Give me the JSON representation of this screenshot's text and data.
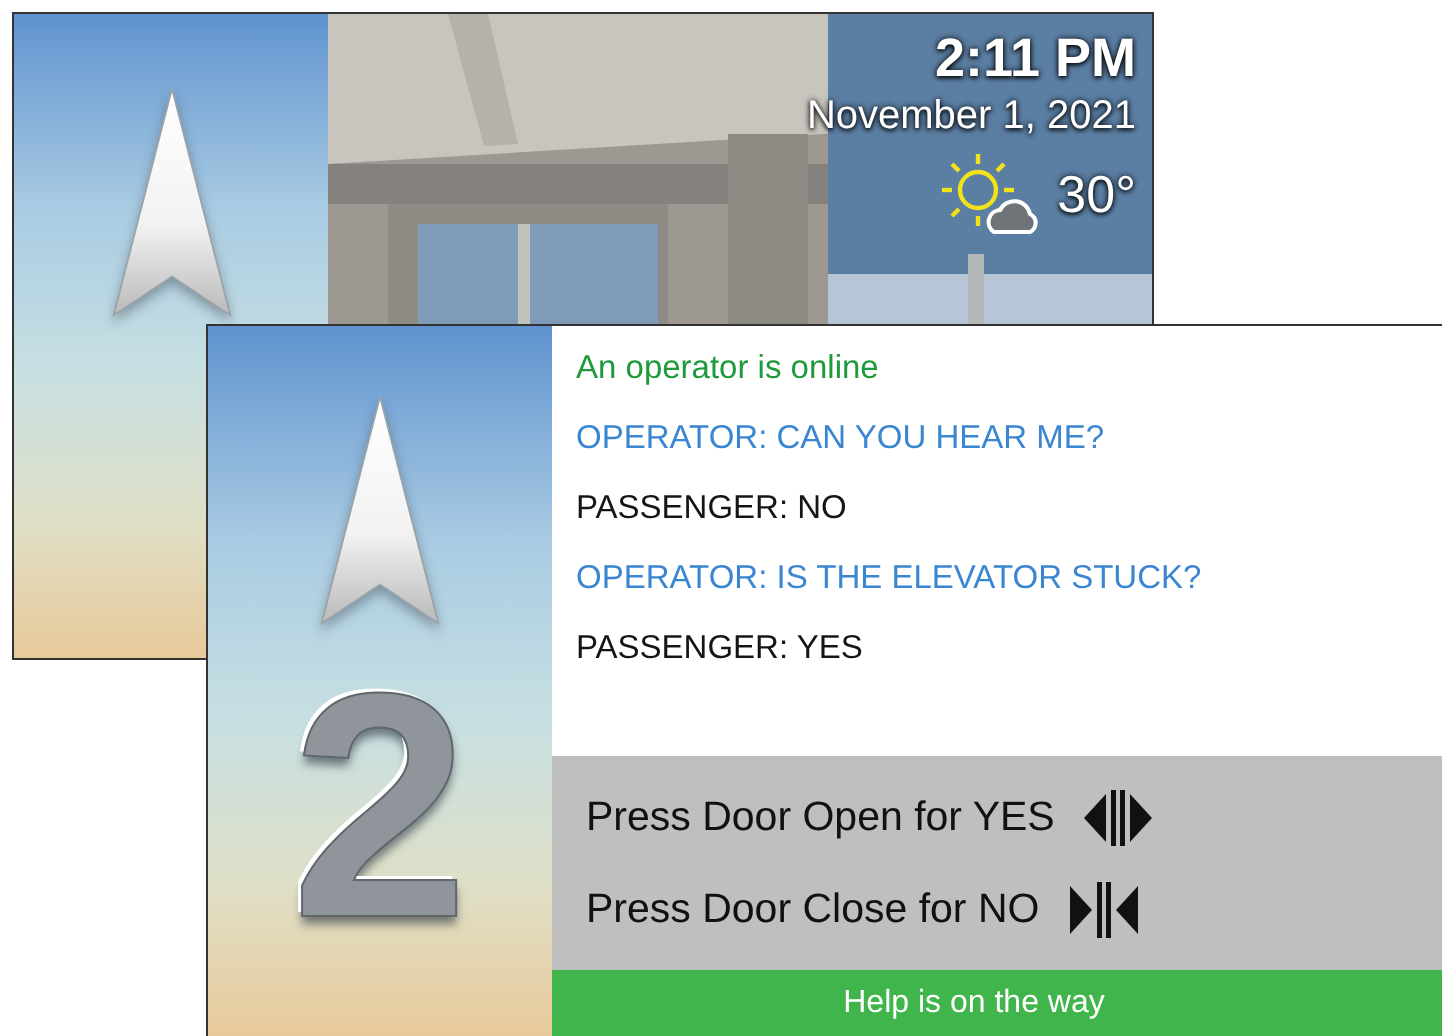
{
  "back_screen": {
    "time": "2:11 PM",
    "date": "November 1, 2021",
    "temperature": "30°"
  },
  "front_screen": {
    "floor": "2",
    "messages": [
      {
        "kind": "status",
        "text": "An operator is online"
      },
      {
        "kind": "operator",
        "text": "OPERATOR: CAN YOU HEAR ME?"
      },
      {
        "kind": "passenger",
        "text": "PASSENGER: NO"
      },
      {
        "kind": "operator",
        "text": "OPERATOR: IS THE ELEVATOR STUCK?"
      },
      {
        "kind": "passenger",
        "text": "PASSENGER: YES"
      }
    ],
    "prompts": [
      {
        "kind": "door-open",
        "text": "Press Door Open for YES"
      },
      {
        "kind": "door-close",
        "text": "Press Door Close for NO"
      }
    ],
    "banner": "Help is on the way"
  }
}
